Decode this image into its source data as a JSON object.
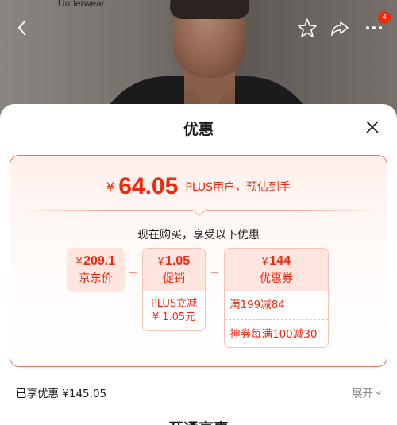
{
  "header": {
    "brand_text": "Underwear",
    "badge_count": "4",
    "icons": [
      "back-icon",
      "star-icon",
      "share-icon",
      "more-icon"
    ]
  },
  "sheet": {
    "title": "优惠",
    "price_symbol": "¥",
    "price": "64.05",
    "price_note": "PLUS用户，预估到手",
    "subtitle": "现在购买，享受以下优惠",
    "jd_price": {
      "value": "209.1",
      "label": "京东价"
    },
    "minus": "–",
    "promo": {
      "value": "1.05",
      "label": "促销",
      "desc_line1": "PLUS立减",
      "desc_line2": "¥ 1.05元"
    },
    "coupon": {
      "value": "144",
      "label": "优惠券",
      "items": [
        "满199减84",
        "神券每满100减30"
      ]
    },
    "enjoyed": "已享优惠 ¥145.05",
    "expand": "展开",
    "next_section_title": "开通享惠"
  },
  "colors": {
    "accent": "#f2270c",
    "accent_bg": "#ffe5df",
    "border": "#f2735b"
  }
}
